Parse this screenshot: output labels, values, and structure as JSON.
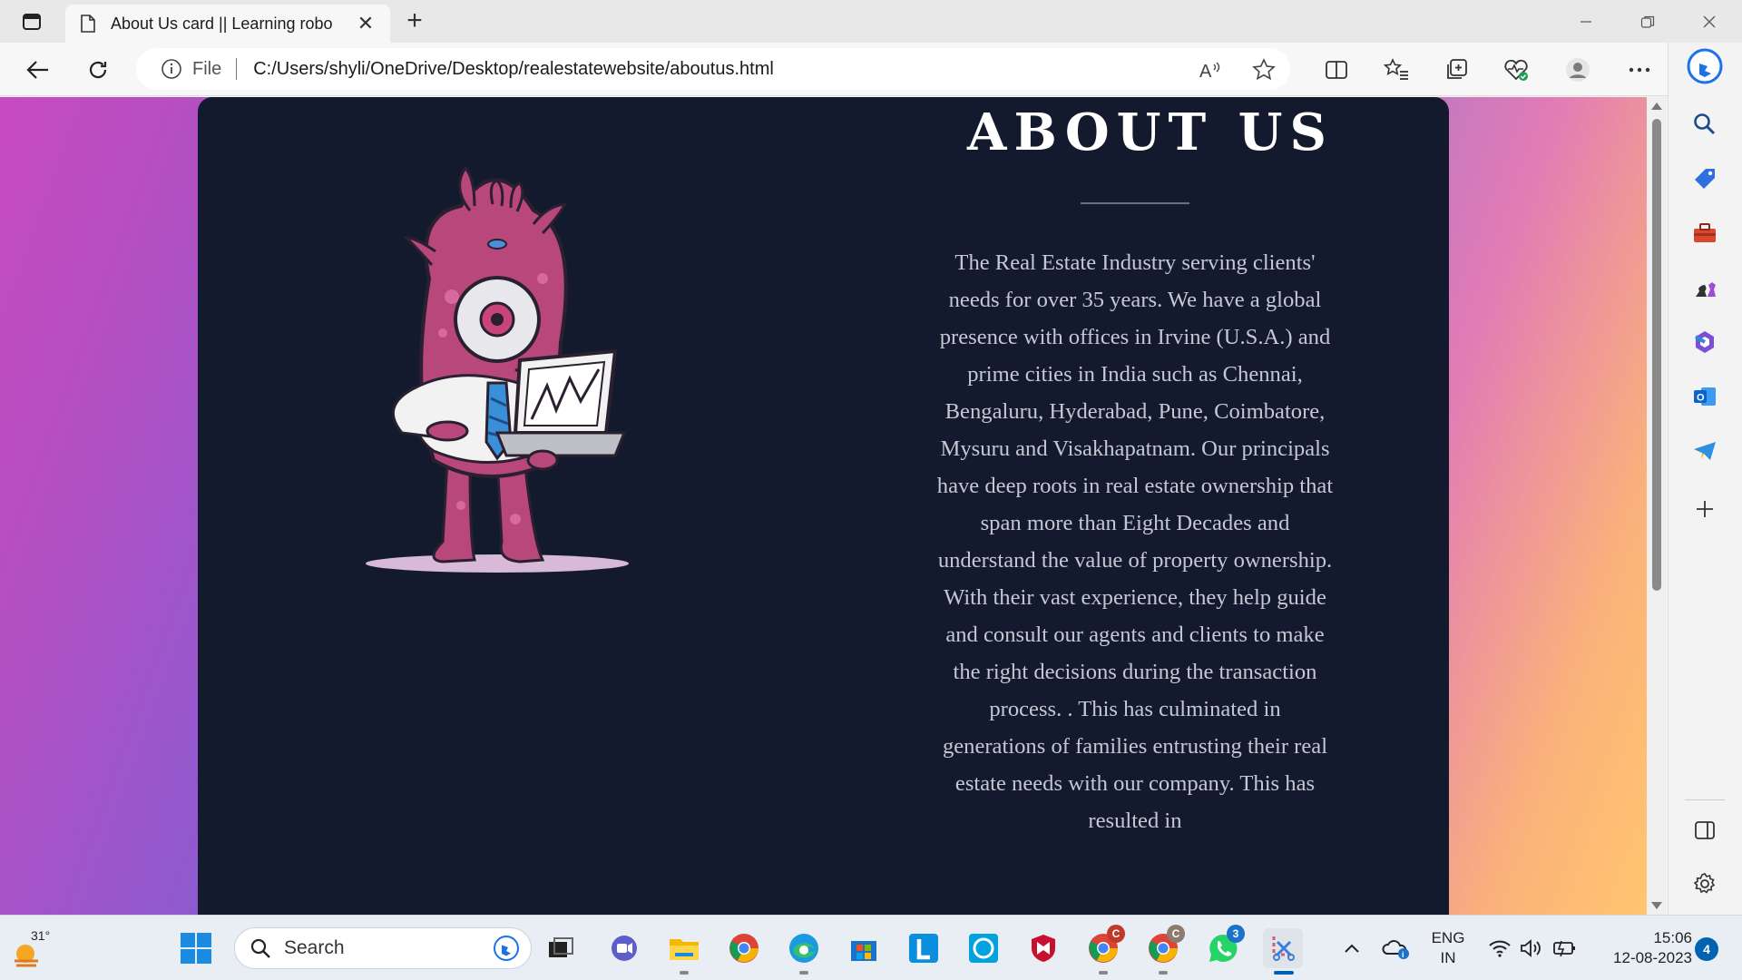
{
  "browser": {
    "tab_title": "About Us card || Learning robo",
    "new_tab_symbol": "+",
    "close_symbol": "✕",
    "address_scheme_label": "File",
    "address_url": "C:/Users/shyli/OneDrive/Desktop/realestatewebsite/aboutus.html"
  },
  "page": {
    "heading": "ABOUT US",
    "paragraph": "The Real Estate Industry serving clients' needs for over 35 years. We have a global presence with offices in Irvine (U.S.A.) and prime cities in India such as Chennai, Bengaluru, Hyderabad, Pune, Coimbatore, Mysuru and Visakhapatnam. Our principals have deep roots in real estate ownership that span more than Eight Decades and understand the value of property ownership. With their vast experience, they help guide and consult our agents and clients to make the right decisions during the transaction process. . This has culminated in generations of families entrusting their real estate needs with our company. This has resulted in",
    "illustration": "pink-one-eyed-monster-with-laptop"
  },
  "sidebar_icons": [
    "search-icon",
    "shopping-tag-icon",
    "toolbox-icon",
    "chess-icon",
    "office-icon",
    "outlook-icon",
    "telegram-icon",
    "add-icon",
    "sidebar-toggle-icon",
    "settings-icon"
  ],
  "taskbar": {
    "weather_temp": "31°",
    "search_label": "Search",
    "apps": [
      "task-view",
      "teams",
      "file-explorer",
      "chrome",
      "edge",
      "microsoft-store",
      "l-app",
      "alexa",
      "mcafee",
      "chrome-profile-c1",
      "chrome-profile-c2",
      "whatsapp",
      "snipping-tool"
    ],
    "whatsapp_badge": "3",
    "chrome_badge_1": "C",
    "chrome_badge_2": "C",
    "language_line1": "ENG",
    "language_line2": "IN",
    "time": "15:06",
    "date": "12-08-2023",
    "notification_count": "4"
  },
  "colors": {
    "card_bg": "#141a2e",
    "text": "#c6c7d3",
    "heading": "#ffffff",
    "gradient_left": "#c74ac0",
    "gradient_right": "#ffc56f",
    "mascot_pink": "#b8477c"
  }
}
